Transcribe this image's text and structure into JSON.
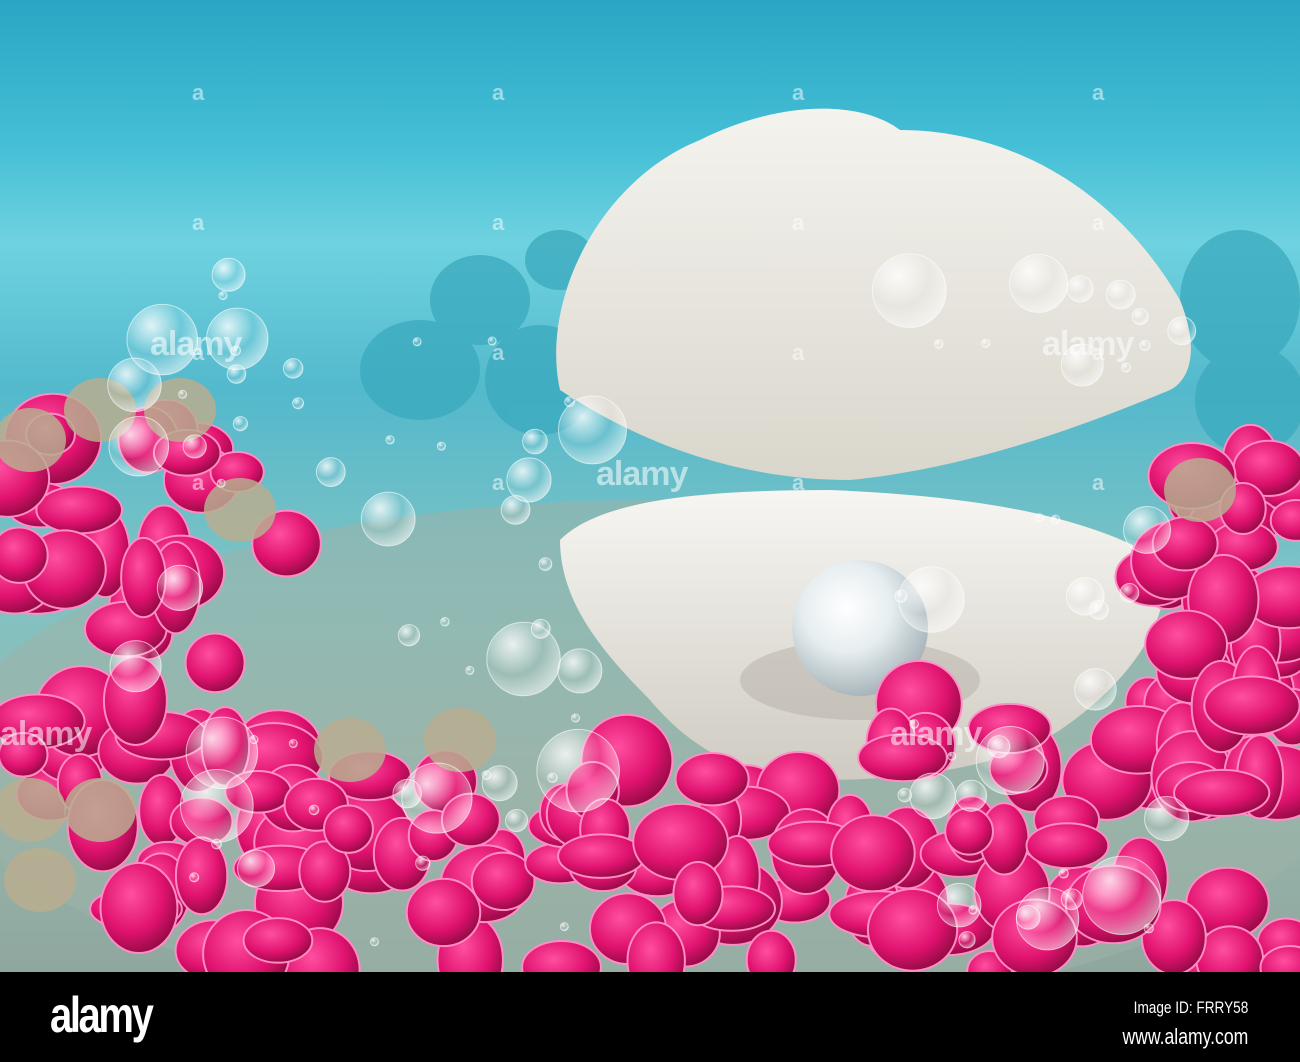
{
  "scene": {
    "subject": "pearl-in-open-shell",
    "colors": {
      "water": "#45bfd6",
      "coral": "#e0126f",
      "shell": "#f2f0ea",
      "pearl": "#e8eef0"
    }
  },
  "watermark": {
    "text": "alamy",
    "short": "a"
  },
  "footer": {
    "logo": "alamy",
    "image_id": "Image ID: FRRY58",
    "url": "www.alamy.com"
  }
}
